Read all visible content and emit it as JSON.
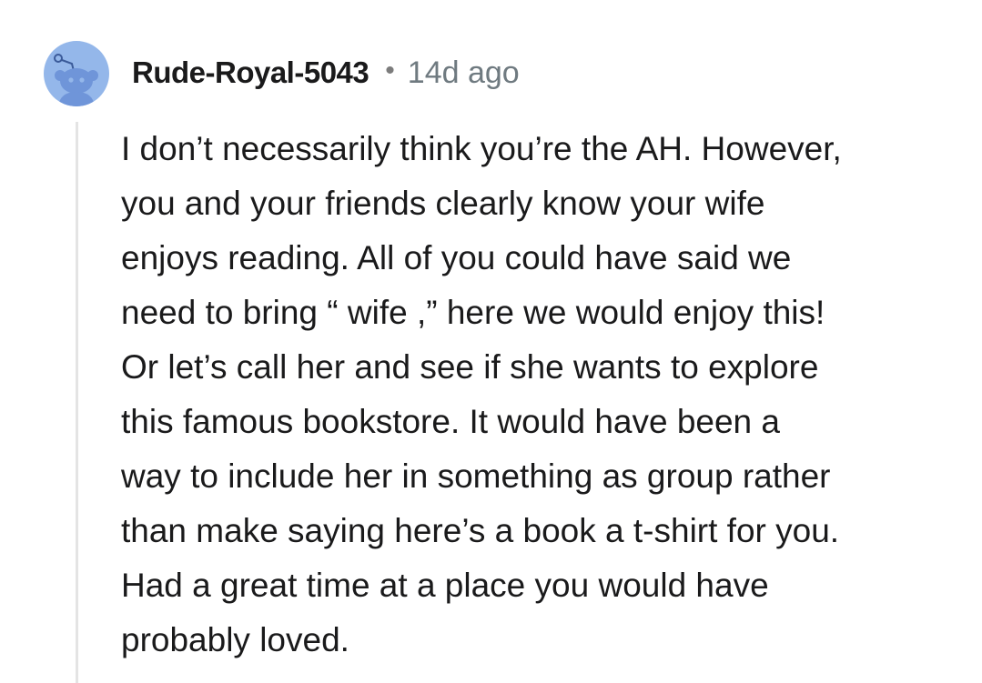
{
  "comment": {
    "username": "Rude-Royal-5043",
    "separator": "•",
    "timestamp": "14d ago",
    "avatar_icon": "reddit-snoo-icon",
    "body_lines": [
      "I don’t necessarily think you’re the AH. However,",
      "you and your friends clearly know your wife",
      "enjoys reading. All of you could have said we",
      "need to bring “ wife ,” here we would enjoy this!",
      "Or let’s call her and see if she wants to explore",
      "this famous bookstore. It would have been a",
      "way to include her in something as group rather",
      "than make saying here’s a book a t-shirt for you.",
      "Had a great time at a place you would have",
      "probably loved."
    ]
  },
  "colors": {
    "avatar_background": "#94b7ea",
    "username": "#1a1a1b",
    "timestamp": "#6f7a80",
    "body_text": "#1a1a1b",
    "thread_line": "#e4e4e4"
  }
}
